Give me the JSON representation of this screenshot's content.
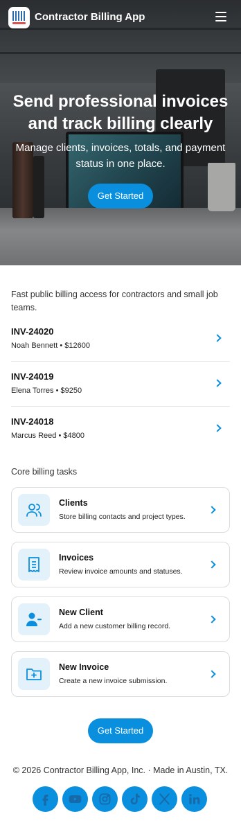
{
  "app": {
    "name": "Contractor Billing App"
  },
  "hero": {
    "title": "Send professional invoices and track billing clearly",
    "subtitle": "Manage clients, invoices, totals, and payment status in one place.",
    "cta": "Get Started"
  },
  "intro": "Fast public billing access for contractors and small job teams.",
  "invoices": [
    {
      "number": "INV-24020",
      "meta": "Noah Bennett • $12600"
    },
    {
      "number": "INV-24019",
      "meta": "Elena Torres • $9250"
    },
    {
      "number": "INV-24018",
      "meta": "Marcus Reed • $4800"
    }
  ],
  "tasks": {
    "heading": "Core billing tasks",
    "items": [
      {
        "title": "Clients",
        "desc": "Store billing contacts and project types.",
        "icon": "users-icon"
      },
      {
        "title": "Invoices",
        "desc": "Review invoice amounts and statuses.",
        "icon": "receipt-icon"
      },
      {
        "title": "New Client",
        "desc": "Add a new customer billing record.",
        "icon": "user-minus-icon"
      },
      {
        "title": "New Invoice",
        "desc": "Create a new invoice submission.",
        "icon": "folder-plus-icon"
      }
    ]
  },
  "cta_bottom": "Get Started",
  "footer": "© 2026 Contractor Billing App, Inc. · Made in Austin, TX.",
  "social": [
    "facebook-icon",
    "youtube-icon",
    "instagram-icon",
    "tiktok-icon",
    "x-icon",
    "linkedin-icon"
  ],
  "colors": {
    "accent": "#0a8fde",
    "icon_bg": "#e3f1fb"
  }
}
